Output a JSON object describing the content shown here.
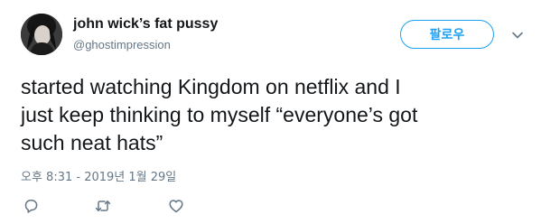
{
  "author": {
    "display_name": "john wick’s fat pussy",
    "handle": "@ghostimpression",
    "avatar_icon": "profile-photo"
  },
  "follow_button": {
    "label": "팔로우"
  },
  "menu_icon": "chevron-down-icon",
  "tweet": {
    "text": "started watching Kingdom on netflix and I\njust keep thinking to myself “everyone’s got\nsuch neat hats”",
    "timestamp": "오후 8:31 - 2019년 1월 29일"
  },
  "actions": {
    "icons": [
      "reply-icon",
      "retweet-icon",
      "like-icon"
    ]
  },
  "colors": {
    "accent": "#1da1f2",
    "text": "#14171a",
    "muted": "#657786"
  }
}
